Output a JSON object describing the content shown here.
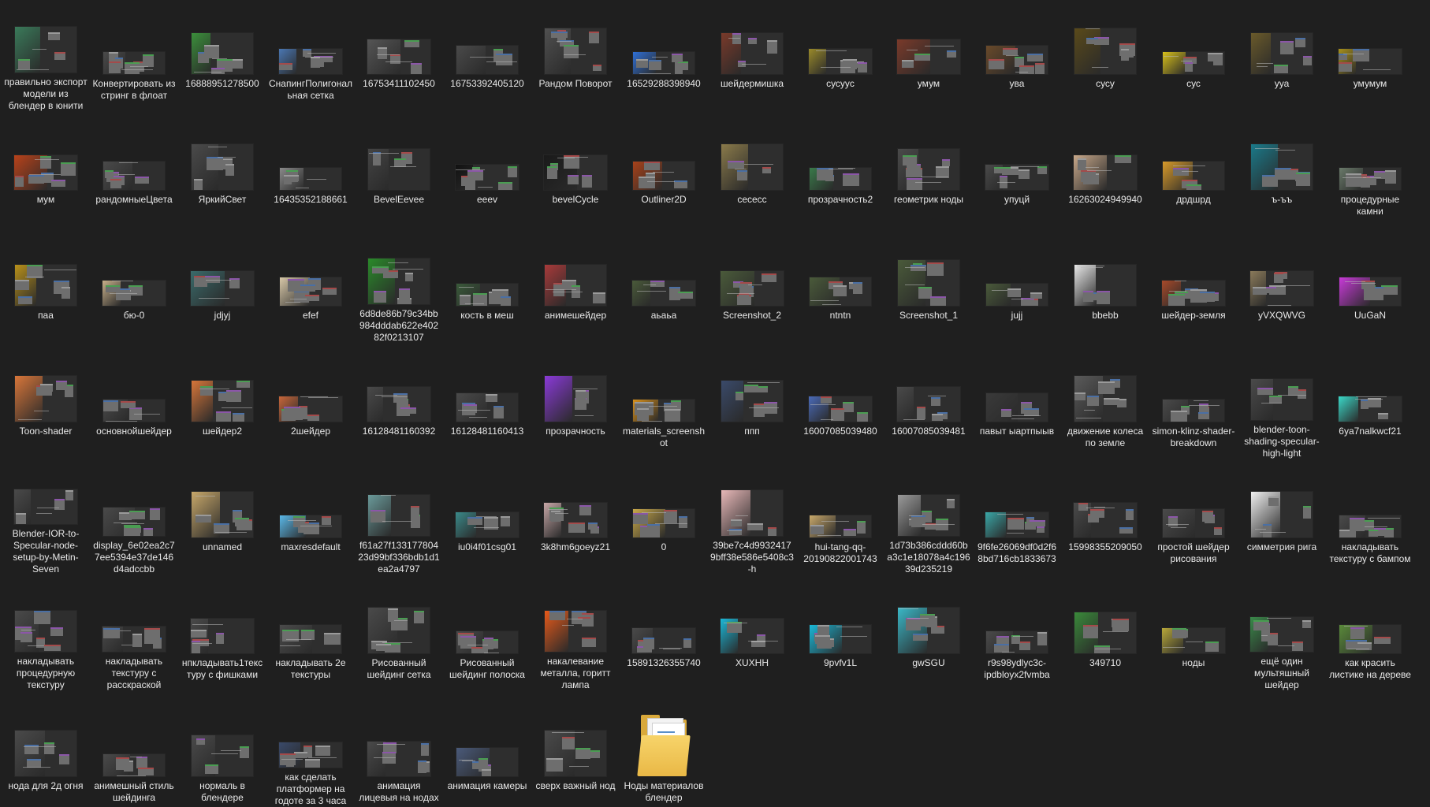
{
  "items": [
    {
      "label": "правильно экспорт модели из блендер в юнити",
      "icon": "image-thumbnail-icon",
      "accent": "#3a7a5a"
    },
    {
      "label": "Конвертировать из стринг в флоат",
      "icon": "image-thumbnail-icon",
      "accent": "#4a4a4a"
    },
    {
      "label": "16888951278500",
      "icon": "image-thumbnail-icon",
      "accent": "#3b8f3b"
    },
    {
      "label": "СнапингПолигональная сетка",
      "icon": "image-thumbnail-icon",
      "accent": "#4a77b3"
    },
    {
      "label": "16753411102450",
      "icon": "image-thumbnail-icon",
      "accent": "#555555"
    },
    {
      "label": "16753392405120",
      "icon": "image-thumbnail-icon",
      "accent": "#4a4a4a"
    },
    {
      "label": "Рандом Поворот",
      "icon": "image-thumbnail-icon",
      "accent": "#505050"
    },
    {
      "label": "16529288398940",
      "icon": "image-thumbnail-icon",
      "accent": "#2f6fd6"
    },
    {
      "label": "шейдермишка",
      "icon": "image-thumbnail-icon",
      "accent": "#7a3a2a"
    },
    {
      "label": "сусууc",
      "icon": "image-thumbnail-icon",
      "accent": "#9a8a2a"
    },
    {
      "label": "умум",
      "icon": "image-thumbnail-icon",
      "accent": "#7a3a2a"
    },
    {
      "label": "ува",
      "icon": "image-thumbnail-icon",
      "accent": "#6a4a2a"
    },
    {
      "label": "сусу",
      "icon": "image-thumbnail-icon",
      "accent": "#5a4a1a"
    },
    {
      "label": "сус",
      "icon": "image-thumbnail-icon",
      "accent": "#d8c11a"
    },
    {
      "label": "ууа",
      "icon": "image-thumbnail-icon",
      "accent": "#6a5a2a"
    },
    {
      "label": "умумум",
      "icon": "image-thumbnail-icon",
      "accent": "#a8901a"
    },
    {
      "label": "мум",
      "icon": "image-thumbnail-icon",
      "accent": "#b8421a"
    },
    {
      "label": "рандомныеЦвета",
      "icon": "image-thumbnail-icon",
      "accent": "#4a4a4a"
    },
    {
      "label": "ЯркийСвет",
      "icon": "image-thumbnail-icon",
      "accent": "#4a4a4a"
    },
    {
      "label": "16435352188661",
      "icon": "image-thumbnail-icon",
      "accent": "#8a8a8a"
    },
    {
      "label": "BevelEevee",
      "icon": "image-thumbnail-icon",
      "accent": "#444444"
    },
    {
      "label": "eeev",
      "icon": "image-thumbnail-icon",
      "accent": "#111111"
    },
    {
      "label": "bevelCycle",
      "icon": "image-thumbnail-icon",
      "accent": "#1a1a1a"
    },
    {
      "label": "Outliner2D",
      "icon": "image-thumbnail-icon",
      "accent": "#a8421a"
    },
    {
      "label": "сесесс",
      "icon": "image-thumbnail-icon",
      "accent": "#8a7a4a"
    },
    {
      "label": "прозрачность2",
      "icon": "image-thumbnail-icon",
      "accent": "#3a7a4a"
    },
    {
      "label": "геометрик ноды",
      "icon": "image-thumbnail-icon",
      "accent": "#4a4a4a"
    },
    {
      "label": "упуцй",
      "icon": "image-thumbnail-icon",
      "accent": "#4a4a4a"
    },
    {
      "label": "16263024949940",
      "icon": "image-thumbnail-icon",
      "accent": "#c8a88a"
    },
    {
      "label": "дрдшрд",
      "icon": "image-thumbnail-icon",
      "accent": "#d89a2a"
    },
    {
      "label": "ъ-ъъ",
      "icon": "image-thumbnail-icon",
      "accent": "#1a7a8a"
    },
    {
      "label": "процедурные камни",
      "icon": "image-thumbnail-icon",
      "accent": "#6a7a6a"
    },
    {
      "label": "паа",
      "icon": "image-thumbnail-icon",
      "accent": "#b8901a"
    },
    {
      "label": "бю-0",
      "icon": "image-thumbnail-icon",
      "accent": "#c8b08a"
    },
    {
      "label": "jdjyj",
      "icon": "image-thumbnail-icon",
      "accent": "#3a6a6a"
    },
    {
      "label": "efef",
      "icon": "image-thumbnail-icon",
      "accent": "#d8c8a8"
    },
    {
      "label": "6d8de86b79c34bb984dddab622e40282f0213107",
      "icon": "image-thumbnail-icon",
      "accent": "#2a8a2a"
    },
    {
      "label": "кость в меш",
      "icon": "image-thumbnail-icon",
      "accent": "#3a5a3a"
    },
    {
      "label": "анимешейдер",
      "icon": "image-thumbnail-icon",
      "accent": "#a83a3a"
    },
    {
      "label": "аьаьа",
      "icon": "image-thumbnail-icon",
      "accent": "#4a5a3a"
    },
    {
      "label": "Screenshot_2",
      "icon": "image-thumbnail-icon",
      "accent": "#4a5a3a"
    },
    {
      "label": "ntntn",
      "icon": "image-thumbnail-icon",
      "accent": "#4a5a3a"
    },
    {
      "label": "Screenshot_1",
      "icon": "image-thumbnail-icon",
      "accent": "#4a5a3a"
    },
    {
      "label": "jujj",
      "icon": "image-thumbnail-icon",
      "accent": "#4a5a3a"
    },
    {
      "label": "bbebb",
      "icon": "image-thumbnail-icon",
      "accent": "#e8e8e8"
    },
    {
      "label": "шейдер-земля",
      "icon": "image-thumbnail-icon",
      "accent": "#a84a2a"
    },
    {
      "label": "yVXQWVG",
      "icon": "image-thumbnail-icon",
      "accent": "#8a7a5a"
    },
    {
      "label": "UuGaN",
      "icon": "image-thumbnail-icon",
      "accent": "#c83ad8"
    },
    {
      "label": "Toon-shader",
      "icon": "image-thumbnail-icon",
      "accent": "#d8763a"
    },
    {
      "label": "основнойшейдер",
      "icon": "image-thumbnail-icon",
      "accent": "#4a4a4a"
    },
    {
      "label": "шейдер2",
      "icon": "image-thumbnail-icon",
      "accent": "#d8763a"
    },
    {
      "label": "2шейдер",
      "icon": "image-thumbnail-icon",
      "accent": "#c8663a"
    },
    {
      "label": "16128481160392",
      "icon": "image-thumbnail-icon",
      "accent": "#4a4a4a"
    },
    {
      "label": "16128481160413",
      "icon": "image-thumbnail-icon",
      "accent": "#4a4a4a"
    },
    {
      "label": "прозрачность",
      "icon": "image-thumbnail-icon",
      "accent": "#8a3ad8"
    },
    {
      "label": "materials_screenshot",
      "icon": "image-thumbnail-icon",
      "accent": "#d8901a"
    },
    {
      "label": "ппп",
      "icon": "image-thumbnail-icon",
      "accent": "#3a4a6a"
    },
    {
      "label": "16007085039480",
      "icon": "image-thumbnail-icon",
      "accent": "#4a6ab8"
    },
    {
      "label": "16007085039481",
      "icon": "image-thumbnail-icon",
      "accent": "#4a4a4a"
    },
    {
      "label": "павыт ыартпыыв",
      "icon": "image-thumbnail-icon",
      "accent": "#3a3a3a"
    },
    {
      "label": "движение колеса по земле",
      "icon": "image-thumbnail-icon",
      "accent": "#5a5a5a"
    },
    {
      "label": "simon-klinz-shader-breakdown",
      "icon": "image-thumbnail-icon",
      "accent": "#4a4a4a"
    },
    {
      "label": "blender-toon-shading-specular-high-light",
      "icon": "image-thumbnail-icon",
      "accent": "#4a4a4a"
    },
    {
      "label": "6ya7nalkwcf21",
      "icon": "image-thumbnail-icon",
      "accent": "#3ad8c8"
    },
    {
      "label": "Blender-IOR-to-Specular-node-setup-by-Metin-Seven",
      "icon": "image-thumbnail-icon",
      "accent": "#4a4a4a"
    },
    {
      "label": "display_6e02ea2c77ee5394e37de146d4adccbb",
      "icon": "image-thumbnail-icon",
      "accent": "#4a4a4a"
    },
    {
      "label": "unnamed",
      "icon": "image-thumbnail-icon",
      "accent": "#c8a86a"
    },
    {
      "label": "maxresdefault",
      "icon": "image-thumbnail-icon",
      "accent": "#5ab8e8"
    },
    {
      "label": "f61a27f13317780423d99bf336bdb1d1ea2a4797",
      "icon": "image-thumbnail-icon",
      "accent": "#6a9a9a"
    },
    {
      "label": "iu0i4f01csg01",
      "icon": "image-thumbnail-icon",
      "accent": "#3a8a8a"
    },
    {
      "label": "3k8hm6goeyz21",
      "icon": "image-thumbnail-icon",
      "accent": "#c8a8a8"
    },
    {
      "label": "0",
      "icon": "image-thumbnail-icon",
      "accent": "#c8a84a"
    },
    {
      "label": "39be7c4d99324179bff38e586e5408c3-h",
      "icon": "image-thumbnail-icon",
      "accent": "#e8b8b8"
    },
    {
      "label": "hui-tang-qq-20190822001743",
      "icon": "image-thumbnail-icon",
      "accent": "#c8a86a"
    },
    {
      "label": "1d73b386cddd60ba3c1e18078a4c19639d235219",
      "icon": "image-thumbnail-icon",
      "accent": "#9a9a9a"
    },
    {
      "label": "9f6fe26069df0d2f68bd716cb1833673",
      "icon": "image-thumbnail-icon",
      "accent": "#3aa8a8"
    },
    {
      "label": "15998355209050",
      "icon": "image-thumbnail-icon",
      "accent": "#4a4a4a"
    },
    {
      "label": "простой шейдер рисования",
      "icon": "image-thumbnail-icon",
      "accent": "#4a4a4a"
    },
    {
      "label": "симметрия рига",
      "icon": "image-thumbnail-icon",
      "accent": "#f0f0f0"
    },
    {
      "label": "накладывать текстуру с бампом",
      "icon": "image-thumbnail-icon",
      "accent": "#4a4a4a"
    },
    {
      "label": "накладывать процедурную текстуру",
      "icon": "image-thumbnail-icon",
      "accent": "#4a4a4a"
    },
    {
      "label": "накладывать текстуру с расскраской",
      "icon": "image-thumbnail-icon",
      "accent": "#4a4a4a"
    },
    {
      "label": "нпкладывать1текстуру с фишками",
      "icon": "image-thumbnail-icon",
      "accent": "#4a4a4a"
    },
    {
      "label": "накладывать 2е текстуры",
      "icon": "image-thumbnail-icon",
      "accent": "#4a4a4a"
    },
    {
      "label": "Рисованный шейдинг сетка",
      "icon": "image-thumbnail-icon",
      "accent": "#4a4a4a"
    },
    {
      "label": "Рисованный шейдинг полоска",
      "icon": "image-thumbnail-icon",
      "accent": "#4a4a4a"
    },
    {
      "label": "накалевание металла, горитт лампа",
      "icon": "image-thumbnail-icon",
      "accent": "#e85a1a"
    },
    {
      "label": "15891326355740",
      "icon": "image-thumbnail-icon",
      "accent": "#4a4a4a"
    },
    {
      "label": "XUXHH",
      "icon": "image-thumbnail-icon",
      "accent": "#1ab8d8"
    },
    {
      "label": "9pvfv1L",
      "icon": "image-thumbnail-icon",
      "accent": "#1ab8d8"
    },
    {
      "label": "gwSGU",
      "icon": "image-thumbnail-icon",
      "accent": "#3ab8c8"
    },
    {
      "label": "r9s98ydlyc3c-ipdbloyx2fvmba",
      "icon": "image-thumbnail-icon",
      "accent": "#4a4a4a"
    },
    {
      "label": "349710",
      "icon": "image-thumbnail-icon",
      "accent": "#3a8a3a"
    },
    {
      "label": "ноды",
      "icon": "image-thumbnail-icon",
      "accent": "#b8a83a"
    },
    {
      "label": "ещё один мультяшный шейдер",
      "icon": "image-thumbnail-icon",
      "accent": "#3a8a4a"
    },
    {
      "label": "как красить листике на дереве",
      "icon": "image-thumbnail-icon",
      "accent": "#5a8a3a"
    },
    {
      "label": "нода для 2д огня",
      "icon": "image-thumbnail-icon",
      "accent": "#4a4a4a"
    },
    {
      "label": "анимешный стиль шейдинга",
      "icon": "image-thumbnail-icon",
      "accent": "#4a4a4a"
    },
    {
      "label": "нормаль в блендере",
      "icon": "image-thumbnail-icon",
      "accent": "#4a4a4a"
    },
    {
      "label": "как сделать платформер на годоте за 3 часа",
      "icon": "image-thumbnail-icon",
      "accent": "#3a4a6a"
    },
    {
      "label": "анимация лицевыя на нодах",
      "icon": "image-thumbnail-icon",
      "accent": "#4a4a4a"
    },
    {
      "label": "анимация камеры",
      "icon": "image-thumbnail-icon",
      "accent": "#4a5a7a"
    },
    {
      "label": "сверх важный нод",
      "icon": "image-thumbnail-icon",
      "accent": "#4a4a4a"
    },
    {
      "label": "Ноды материалов блендер",
      "icon": "folder-icon",
      "accent": "#e9b846"
    }
  ]
}
